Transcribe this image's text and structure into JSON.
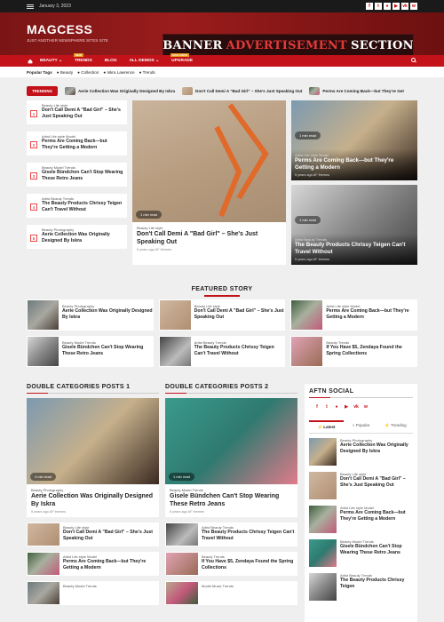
{
  "topbar": {
    "date": "January 3, 2023",
    "social": [
      "f",
      "t",
      "●",
      "▶",
      "vk",
      "w"
    ]
  },
  "header": {
    "logo": "MAGCESS",
    "tagline": "JUST ANOTHER NEWSPHERE SITES SITE",
    "banner_white": "BANNER",
    "banner_red": "ADVERTISEMENT",
    "banner_white2": "SECTION"
  },
  "nav": {
    "items": [
      "BEAUTY ⌄",
      "TRENDS",
      "BLOG",
      "ALL DEMOS ⌄",
      "UPGRADE"
    ],
    "badges": {
      "trends": "NEW",
      "upgrade": "EXCLUSIVE"
    }
  },
  "popular": {
    "label": "Popular Tags",
    "tags": [
      "Beauty",
      "Collection",
      "Iskra Lawrence",
      "Trends"
    ]
  },
  "trending": {
    "label": "TRENDING",
    "items": [
      "Aerie Collection Was Originally Designed By Iskra",
      "Don't Call Demi A \"Bad Girl\" – She's Just Speaking Out",
      "Perms Are Coming Back—but They're Get"
    ]
  },
  "left_list": [
    {
      "num": "1",
      "cat": "Beauty  Life style",
      "title": "Don't Call Demi A \"Bad Girl\" – She's Just Speaking Out"
    },
    {
      "num": "2",
      "cat": "Artist  Life style  Model",
      "title": "Perms Are Coming Back—but They're Getting a Modern"
    },
    {
      "num": "3",
      "cat": "Beauty  Model  Trends",
      "title": "Gisele Bündchen Can't Stop Wearing These Retro Jeans"
    },
    {
      "num": "4",
      "cat": "Artist  Beauty  Trends",
      "title": "The Beauty Products Chrissy Teigen Can't Travel Without"
    },
    {
      "num": "5",
      "cat": "Beauty  Photography",
      "title": "Aerie Collection Was Originally Designed By Iskra"
    }
  ],
  "feature": {
    "readtime": "1 min read",
    "cat": "Beauty  Life style",
    "title": "Don't Call Demi A \"Bad Girl\" – She's Just Speaking Out",
    "meta": "5 years ago   AF themes"
  },
  "right_cards": [
    {
      "readtime": "1 min read",
      "cat": "Artist  Life style  Model",
      "title": "Perms Are Coming Back—but They're Getting a Modern",
      "meta": "5 years ago   AF themes"
    },
    {
      "readtime": "1 min read",
      "cat": "Artist  Beauty  Trends",
      "title": "The Beauty Products Chrissy Teigen Can't Travel Without",
      "meta": "5 years ago   AF themes"
    }
  ],
  "featured_story": {
    "heading": "FEATURED STORY",
    "items": [
      {
        "cat": "Beauty  Photography",
        "title": "Aerie Collection Was Originally Designed By Iskra"
      },
      {
        "cat": "Beauty  Life style",
        "title": "Don't Call Demi A \"Bad Girl\" – She's Just Speaking Out"
      },
      {
        "cat": "Artist  Life style  Model",
        "title": "Perms Are Coming Back—but They're Getting a Modern"
      },
      {
        "cat": "Beauty  Model  Trends",
        "title": "Gisele Bündchen Can't Stop Wearing These Retro Jeans"
      },
      {
        "cat": "Artist  Beauty  Trends",
        "title": "The Beauty Products Chrissy Teigen Can't Travel Without"
      },
      {
        "cat": "Beauty  Trends",
        "title": "If You Have $5, Zendaya Found the Spring Collections"
      }
    ]
  },
  "double1": {
    "heading": "DOUBLE CATEGORIES POSTS 1",
    "readtime": "4 min read",
    "cat": "Beauty  Photography",
    "title": "Aerie Collection Was Originally Designed By Iskra",
    "meta": "5 years ago   AF themes",
    "small": [
      {
        "cat": "Beauty  Life style",
        "title": "Don't Call Demi A \"Bad Girl\" – She's Just Speaking Out"
      },
      {
        "cat": "Artist  Life style  Model",
        "title": "Perms Are Coming Back—but They're Getting a Modern"
      },
      {
        "cat": "Beauty  Model  Trends",
        "title": ""
      }
    ]
  },
  "double2": {
    "heading": "DOUBLE CATEGORIES POSTS 2",
    "readtime": "1 min read",
    "cat": "Beauty  Model  Trends",
    "title": "Gisele Bündchen Can't Stop Wearing These Retro Jeans",
    "meta": "5 years ago   AF themes",
    "small": [
      {
        "cat": "Artist  Beauty  Trends",
        "title": "The Beauty Products Chrissy Teigen Can't Travel Without"
      },
      {
        "cat": "Beauty  Trends",
        "title": "If You Have $5, Zendaya Found the Spring Collections"
      },
      {
        "cat": "Model  Music  Trends",
        "title": ""
      }
    ]
  },
  "sidebar": {
    "heading": "AFTN SOCIAL",
    "social": [
      "f",
      "t",
      "●",
      "▶",
      "vk",
      "w"
    ],
    "tabs": [
      "⚡ Latest",
      "○ Popular",
      "⚡ Trending"
    ],
    "items": [
      {
        "cat": "Beauty  Photography",
        "title": "Aerie Collection Was Originally Designed By Iskra"
      },
      {
        "cat": "Beauty  Life style",
        "title": "Don't Call Demi A \"Bad Girl\" – She's Just Speaking Out"
      },
      {
        "cat": "Artist  Life style  Model",
        "title": "Perms Are Coming Back—but They're Getting a Modern"
      },
      {
        "cat": "Beauty  Model  Trends",
        "title": "Gisele Bündchen Can't Stop Wearing These Retro Jeans"
      },
      {
        "cat": "Artist  Beauty  Trends",
        "title": "The Beauty Products Chrissy Teigen"
      }
    ]
  }
}
